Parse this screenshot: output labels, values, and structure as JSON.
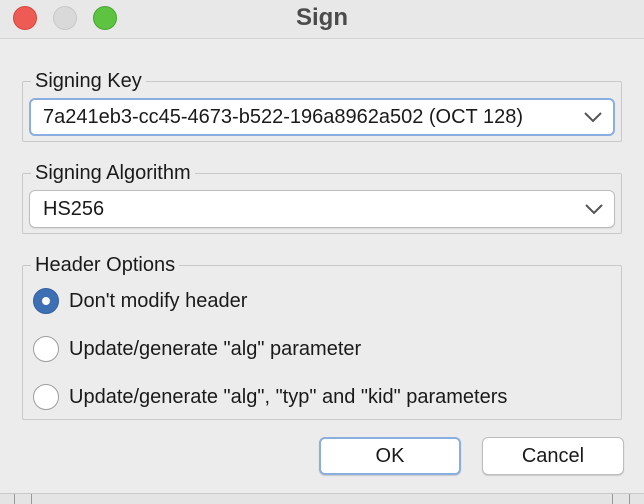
{
  "window": {
    "title": "Sign"
  },
  "signing_key": {
    "label": "Signing Key",
    "value": "7a241eb3-cc45-4673-b522-196a8962a502 (OCT 128)"
  },
  "signing_algorithm": {
    "label": "Signing Algorithm",
    "value": "HS256"
  },
  "header_options": {
    "label": "Header Options",
    "options": [
      {
        "label": "Don't modify header",
        "checked": true
      },
      {
        "label": "Update/generate \"alg\" parameter",
        "checked": false
      },
      {
        "label": "Update/generate \"alg\", \"typ\" and \"kid\" parameters",
        "checked": false
      }
    ]
  },
  "buttons": {
    "ok": "OK",
    "cancel": "Cancel"
  },
  "colors": {
    "accent": "#3d6fb5",
    "focus_ring": "#8aaee0",
    "close": "#ee5b55",
    "maximize": "#5dc341"
  }
}
